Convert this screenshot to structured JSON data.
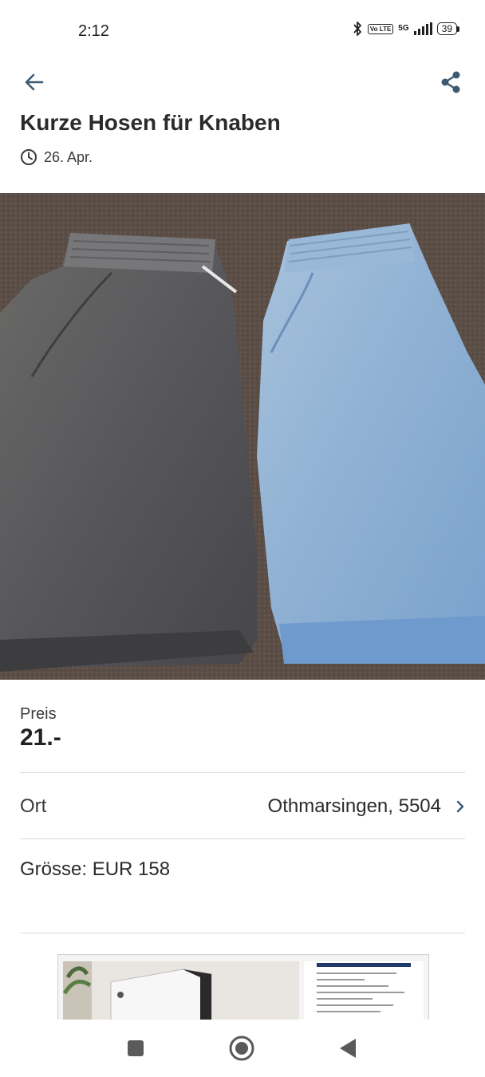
{
  "status_bar": {
    "time": "2:12",
    "network": "5G",
    "volte": "Vo LTE",
    "battery": "39"
  },
  "header": {
    "title": "Kurze Hosen für Knaben",
    "date": "26. Apr."
  },
  "details": {
    "price_label": "Preis",
    "price_value": "21.-",
    "location_label": "Ort",
    "location_value": "Othmarsingen, 5504",
    "description": "Grösse: EUR 158"
  },
  "icons": {
    "back": "arrow-left-icon",
    "share": "share-icon",
    "clock": "clock-icon",
    "chevron": "chevron-right-icon"
  },
  "colors": {
    "accent": "#3d5a73",
    "text": "#2b2b2b",
    "divider": "#dcdcdc"
  }
}
